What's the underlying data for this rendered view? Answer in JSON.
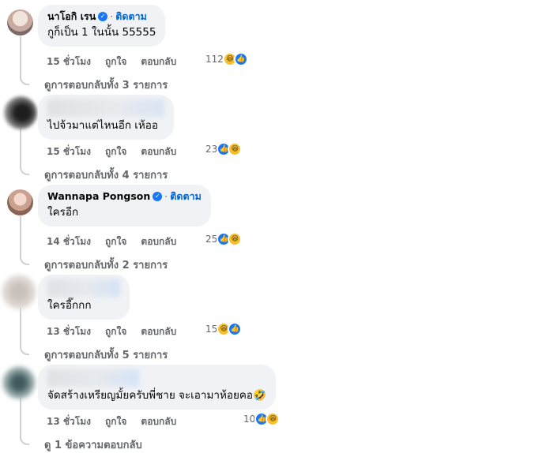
{
  "ui": {
    "dot": "·",
    "verified_glyph": "✓"
  },
  "comments": [
    {
      "name": "นาโอกิ เรน",
      "verified": true,
      "follow": "ติดตาม",
      "text": "กูก็เป็น 1 ในนั้น 55555",
      "time": "15 ชั่วโมง",
      "like": "ถูกใจ",
      "reply": "ตอบกลับ",
      "reaction_count": "112",
      "reactions": [
        "haha",
        "like"
      ],
      "view_replies": "ดูการตอบกลับทั้ง 3 รายการ"
    },
    {
      "name": "",
      "verified": false,
      "follow": "",
      "text": "ไปจ้วมาแต่ไหนอีก เห้ออ",
      "time": "15 ชั่วโมง",
      "like": "ถูกใจ",
      "reply": "ตอบกลับ",
      "reaction_count": "23",
      "reactions": [
        "like",
        "haha"
      ],
      "view_replies": "ดูการตอบกลับทั้ง 4 รายการ"
    },
    {
      "name": "Wannapa Pongson",
      "verified": true,
      "follow": "ติดตาม",
      "text": "ใครอีก",
      "time": "14 ชั่วโมง",
      "like": "ถูกใจ",
      "reply": "ตอบกลับ",
      "reaction_count": "25",
      "reactions": [
        "like",
        "haha"
      ],
      "view_replies": "ดูการตอบกลับทั้ง 2 รายการ"
    },
    {
      "name": "",
      "verified": false,
      "follow": "",
      "text": "ใครอี๊กกก",
      "time": "13 ชั่วโมง",
      "like": "ถูกใจ",
      "reply": "ตอบกลับ",
      "reaction_count": "15",
      "reactions": [
        "haha",
        "like"
      ],
      "view_replies": "ดูการตอบกลับทั้ง 5 รายการ"
    },
    {
      "name": "",
      "verified": false,
      "follow": "",
      "text": "จัดสร้างเหรียญมั้ยครับพี่ชาย จะเอามาห้อยคอ🤣",
      "time": "13 ชั่วโมง",
      "like": "ถูกใจ",
      "reply": "ตอบกลับ",
      "reaction_count": "10",
      "reactions": [
        "like",
        "haha"
      ],
      "view_replies": "ดู 1 ข้อความตอบกลับ"
    }
  ],
  "colors": {
    "bubble": "#f0f2f5",
    "link": "#0064d1",
    "meta": "#65676b",
    "like": "#1877f2",
    "haha": "#f7c02d"
  }
}
